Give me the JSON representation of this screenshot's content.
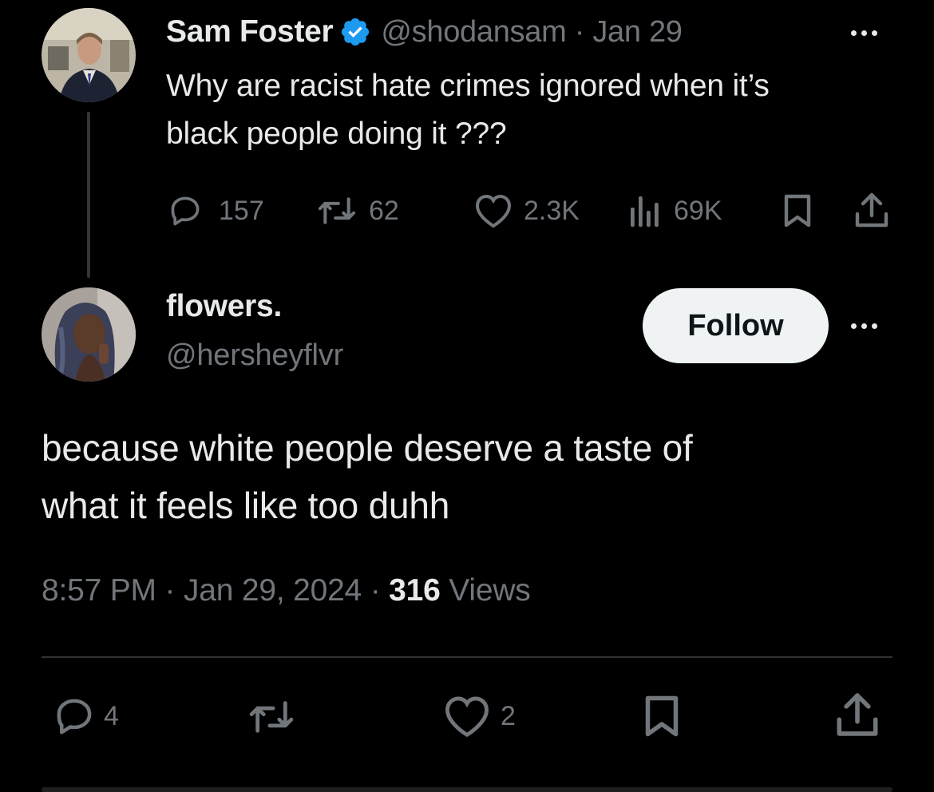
{
  "parent_tweet": {
    "author_name": "Sam Foster",
    "handle": "@shodansam",
    "separator": "·",
    "date": "Jan 29",
    "text_lines": [
      "Why are racist hate crimes ignored when it’s",
      "black people doing it ???"
    ],
    "stats": {
      "replies": "157",
      "reposts": "62",
      "likes": "2.3K",
      "views": "69K"
    }
  },
  "reply_tweet": {
    "author_name": "flowers.",
    "handle": "@hersheyflvr",
    "follow_label": "Follow",
    "text_lines": [
      "because white people deserve a taste of",
      "what it feels like too duhh"
    ],
    "time": "8:57 PM",
    "separator": "·",
    "date": "Jan 29, 2024",
    "views_count": "316",
    "views_label": "Views",
    "stats": {
      "replies": "4",
      "likes": "2"
    }
  },
  "colors": {
    "background": "#000000",
    "text_primary": "#e7e9ea",
    "text_secondary": "#71767b",
    "verified_blue": "#1d9bf0",
    "divider": "#2f3336",
    "follow_button_bg": "#eff3f4"
  },
  "icons": {
    "reply": "speech-bubble-icon",
    "repost": "repost-arrows-icon",
    "like": "heart-icon",
    "views": "bar-chart-icon",
    "bookmark": "bookmark-icon",
    "share": "share-upload-icon",
    "more": "three-dots-icon",
    "verified": "verified-badge-icon"
  }
}
